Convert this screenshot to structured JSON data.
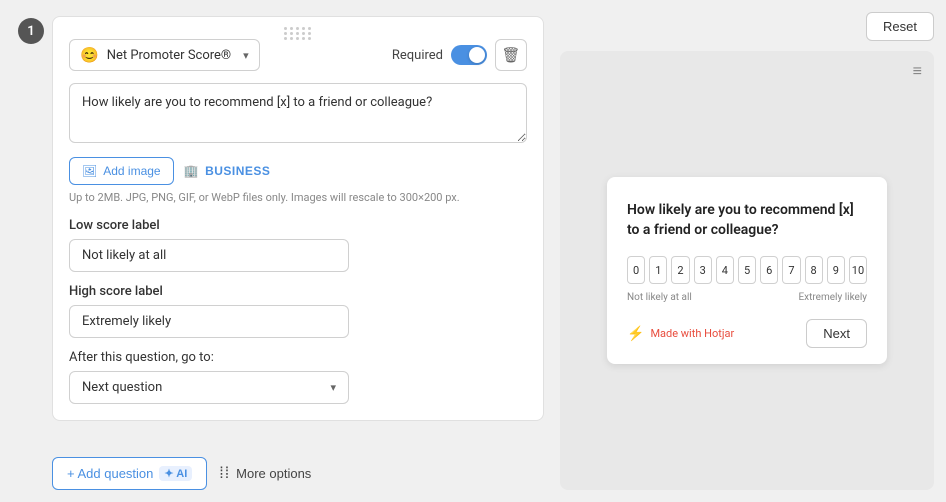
{
  "step": {
    "number": "1"
  },
  "editor": {
    "question_type": {
      "label": "Net Promoter Score®",
      "emoji": "😊"
    },
    "required_label": "Required",
    "question_text": "How likely are you to recommend [x] to a friend or colleague?",
    "add_image_label": "Add image",
    "business_label": "BUSINESS",
    "file_hint": "Up to 2MB. JPG, PNG, GIF, or WebP files only. Images will rescale to 300×200 px.",
    "low_score_label": "Low score label",
    "low_score_value": "Not likely at all",
    "high_score_label": "High score label",
    "high_score_value": "Extremely likely",
    "goto_label": "After this question, go to:",
    "goto_value": "Next question"
  },
  "bottom_bar": {
    "add_question_label": "+ Add question",
    "ai_badge": "✦ AI",
    "more_options_label": "More options"
  },
  "preview": {
    "reset_label": "Reset",
    "question_text": "How likely are you to recommend [x] to a friend or colleague?",
    "nps_numbers": [
      "0",
      "1",
      "2",
      "3",
      "4",
      "5",
      "6",
      "7",
      "8",
      "9",
      "10"
    ],
    "low_label": "Not likely at all",
    "high_label": "Extremely likely",
    "hotjar_text": "Made with Hotjar",
    "next_label": "Next"
  },
  "icons": {
    "drag_dots": "⋯",
    "chevron_down": "▾",
    "delete": "🗑",
    "image": "🖼",
    "building": "🏢",
    "menu": "≡",
    "more_options": "⋮⋮"
  }
}
